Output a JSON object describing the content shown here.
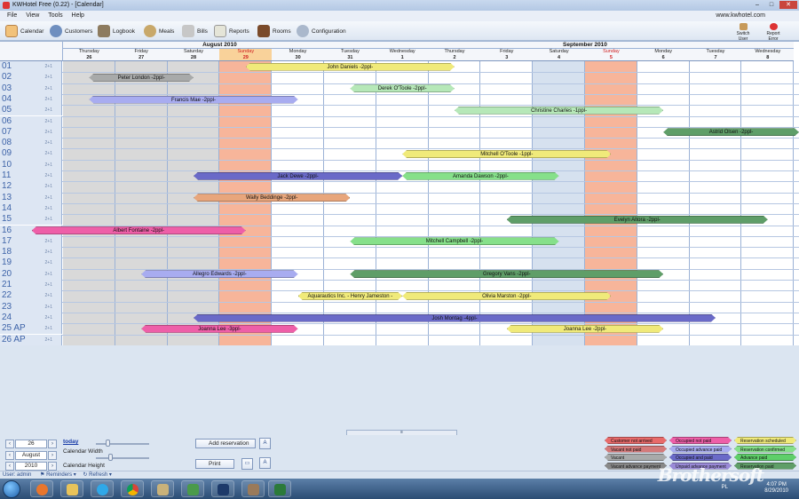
{
  "window": {
    "title": "KWHotel Free (0.22) - [Calendar]"
  },
  "menu": [
    "File",
    "View",
    "Tools",
    "Help"
  ],
  "site": "www.kwhotel.com",
  "toolbar": [
    "Calendar",
    "Customers",
    "Logbook",
    "Meals",
    "Bills",
    "Reports",
    "Rooms",
    "Configuration"
  ],
  "toolbar_right": [
    "Switch User",
    "Report Error"
  ],
  "months": [
    {
      "name": "August 2010",
      "start": 0,
      "span": 6
    },
    {
      "name": "September 2010",
      "start": 6,
      "span": 8
    }
  ],
  "days": [
    {
      "dow": "Thursday",
      "d": "26"
    },
    {
      "dow": "Friday",
      "d": "27"
    },
    {
      "dow": "Saturday",
      "d": "28"
    },
    {
      "dow": "Sunday",
      "d": "29",
      "sunday": true,
      "today": true
    },
    {
      "dow": "Monday",
      "d": "30"
    },
    {
      "dow": "Tuesday",
      "d": "31"
    },
    {
      "dow": "Wednesday",
      "d": "1"
    },
    {
      "dow": "Thursday",
      "d": "2"
    },
    {
      "dow": "Friday",
      "d": "3"
    },
    {
      "dow": "Saturday",
      "d": "4"
    },
    {
      "dow": "Sunday",
      "d": "5",
      "sunday": true
    },
    {
      "dow": "Monday",
      "d": "6"
    },
    {
      "dow": "Tuesday",
      "d": "7"
    },
    {
      "dow": "Wednesday",
      "d": "8"
    }
  ],
  "rooms": [
    "01",
    "02",
    "03",
    "04",
    "05",
    "06",
    "07",
    "08",
    "09",
    "10",
    "11",
    "12",
    "13",
    "14",
    "15",
    "16",
    "17",
    "18",
    "19",
    "20",
    "21",
    "22",
    "23",
    "24",
    "25 AP",
    "26 AP"
  ],
  "room_capacity": "2+1",
  "reservations": [
    {
      "name": "John Daniels -2ppl-",
      "room": 0,
      "start": 3.5,
      "end": 7.5,
      "color": "#f0ea7a"
    },
    {
      "name": "Peter London -2ppl-",
      "room": 1,
      "start": 0.5,
      "end": 2.5,
      "color": "#a8aaaa"
    },
    {
      "name": "Derek O'Toole -2ppl-",
      "room": 2,
      "start": 5.5,
      "end": 7.5,
      "color": "#b6e8b8"
    },
    {
      "name": "Francis Mae -2ppl-",
      "room": 3,
      "start": 0.5,
      "end": 4.5,
      "color": "#a8acf0"
    },
    {
      "name": "Christine Charles -1ppl-",
      "room": 4,
      "start": 7.5,
      "end": 11.5,
      "color": "#b6e8b8"
    },
    {
      "name": "Astrid Olsen -2ppl-",
      "room": 6,
      "start": 11.5,
      "end": 14.2,
      "color": "#5f9e68"
    },
    {
      "name": "Mitchell O'Toole -1ppl-",
      "room": 8,
      "start": 6.5,
      "end": 10.5,
      "color": "#f0ea7a"
    },
    {
      "name": "Jack Dewe -2ppl-",
      "room": 10,
      "start": 2.5,
      "end": 6.5,
      "color": "#6a6ac8"
    },
    {
      "name": "Amanda Dawson -2ppl-",
      "room": 10,
      "start": 6.5,
      "end": 9.5,
      "color": "#86e08a"
    },
    {
      "name": "Wally Beddinge -2ppl-",
      "room": 12,
      "start": 2.5,
      "end": 5.5,
      "color": "#e8a67c"
    },
    {
      "name": "Evelyn Altora -2ppl-",
      "room": 14,
      "start": 8.5,
      "end": 13.5,
      "color": "#5f9e68"
    },
    {
      "name": "Albert Fontaine -2ppl-",
      "room": 15,
      "start": -0.6,
      "end": 3.5,
      "color": "#ee5fa8"
    },
    {
      "name": "Mitchell Campbell -2ppl-",
      "room": 16,
      "start": 5.5,
      "end": 9.5,
      "color": "#86e08a"
    },
    {
      "name": "Allegro Edwards -2ppl-",
      "room": 19,
      "start": 1.5,
      "end": 4.5,
      "color": "#a8acf0"
    },
    {
      "name": "Gregory Vans -2ppl-",
      "room": 19,
      "start": 5.5,
      "end": 11.5,
      "color": "#5f9e68"
    },
    {
      "name": "Aquarautics Inc. - Henry Jameston -",
      "room": 21,
      "start": 4.5,
      "end": 6.5,
      "color": "#f0ea7a"
    },
    {
      "name": "Olivia Marston -2ppl-",
      "room": 21,
      "start": 6.5,
      "end": 10.5,
      "color": "#f0ea7a"
    },
    {
      "name": "Josh Montag -4ppl-",
      "room": 23,
      "start": 2.5,
      "end": 12.5,
      "color": "#6a6ac8"
    },
    {
      "name": "Joanna Lee -3ppl-",
      "room": 24,
      "start": 1.5,
      "end": 4.5,
      "color": "#ee5fa8"
    },
    {
      "name": "Joanna Lee -2ppl-",
      "room": 24,
      "start": 8.5,
      "end": 11.5,
      "color": "#f0ea7a"
    }
  ],
  "controls": {
    "today_link": "today",
    "day": "26",
    "month": "August",
    "year": "2010",
    "width_label": "Calendar Width",
    "height_label": "Calendar Height",
    "width_level": 0.2,
    "height_level": 0.25,
    "add_reservation": "Add reservation",
    "print": "Print"
  },
  "legend": [
    {
      "label": "Customer not arrived",
      "color": "#e86a6a"
    },
    {
      "label": "Occupied not paid",
      "color": "#ee5fa8"
    },
    {
      "label": "Reservation scheduled",
      "color": "#f0ea7a"
    },
    {
      "label": "Vacant not paid",
      "color": "#d47a7a"
    },
    {
      "label": "Occupied advance paid",
      "color": "#a8acf0"
    },
    {
      "label": "Reservation confirmed",
      "color": "#86e08a"
    },
    {
      "label": "Vacant",
      "color": "#a8aaaa"
    },
    {
      "label": "Occupied and paid",
      "color": "#6a6ac8"
    },
    {
      "label": "Advance paid",
      "color": "#5fcf6a"
    },
    {
      "label": "Vacant advance payment",
      "color": "#888888"
    },
    {
      "label": "Unpaid advance payment",
      "color": "#9a8ad8"
    },
    {
      "label": "Reservation paid",
      "color": "#5f9e68"
    }
  ],
  "status": {
    "user": "User: admin",
    "reminders": "Reminders",
    "refresh": "Refresh"
  },
  "taskbar": {
    "lang": "PL",
    "time": "4:07 PM",
    "date": "8/29/2010"
  },
  "watermark": "Brothersoft"
}
